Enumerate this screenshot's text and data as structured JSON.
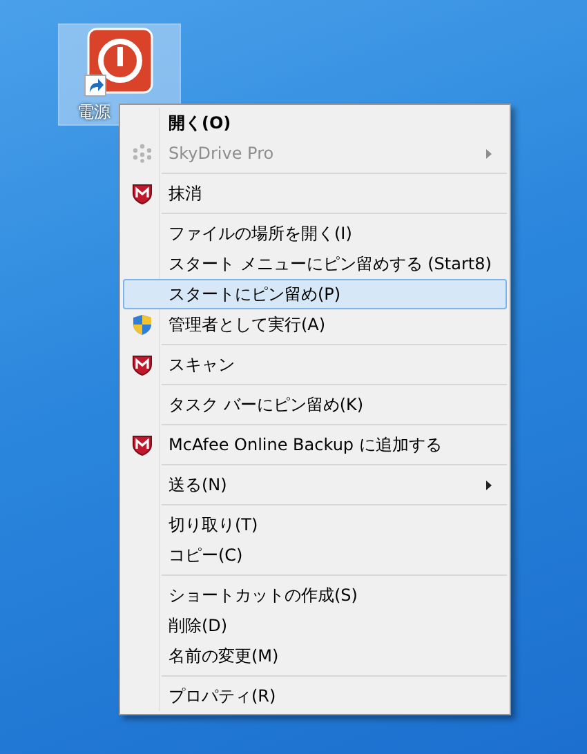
{
  "desktop_icon": {
    "label": "電源",
    "selected": true
  },
  "context_menu": {
    "items": [
      {
        "kind": "item",
        "label": "開く(O)",
        "bold": true,
        "disabled": false,
        "submenu": false,
        "selected": false
      },
      {
        "kind": "cloud-item",
        "label": "SkyDrive Pro",
        "bold": false,
        "disabled": true,
        "submenu": true,
        "selected": false
      },
      {
        "kind": "separator"
      },
      {
        "kind": "mcafee-item",
        "label": "抹消",
        "bold": false,
        "disabled": false,
        "submenu": false,
        "selected": false
      },
      {
        "kind": "separator"
      },
      {
        "kind": "item",
        "label": "ファイルの場所を開く(I)",
        "bold": false,
        "disabled": false,
        "submenu": false,
        "selected": false
      },
      {
        "kind": "item",
        "label": "スタート メニューにピン留めする (Start8)",
        "bold": false,
        "disabled": false,
        "submenu": false,
        "selected": false
      },
      {
        "kind": "item",
        "label": "スタートにピン留め(P)",
        "bold": false,
        "disabled": false,
        "submenu": false,
        "selected": true
      },
      {
        "kind": "admin-item",
        "label": "管理者として実行(A)",
        "bold": false,
        "disabled": false,
        "submenu": false,
        "selected": false
      },
      {
        "kind": "separator"
      },
      {
        "kind": "mcafee-item",
        "label": "スキャン",
        "bold": false,
        "disabled": false,
        "submenu": false,
        "selected": false
      },
      {
        "kind": "separator"
      },
      {
        "kind": "item",
        "label": "タスク バーにピン留め(K)",
        "bold": false,
        "disabled": false,
        "submenu": false,
        "selected": false
      },
      {
        "kind": "separator"
      },
      {
        "kind": "mcafee-item",
        "label": "McAfee Online Backup に追加する",
        "bold": false,
        "disabled": false,
        "submenu": false,
        "selected": false
      },
      {
        "kind": "separator"
      },
      {
        "kind": "item",
        "label": "送る(N)",
        "bold": false,
        "disabled": false,
        "submenu": true,
        "selected": false
      },
      {
        "kind": "separator"
      },
      {
        "kind": "item",
        "label": "切り取り(T)",
        "bold": false,
        "disabled": false,
        "submenu": false,
        "selected": false
      },
      {
        "kind": "item",
        "label": "コピー(C)",
        "bold": false,
        "disabled": false,
        "submenu": false,
        "selected": false
      },
      {
        "kind": "separator"
      },
      {
        "kind": "item",
        "label": "ショートカットの作成(S)",
        "bold": false,
        "disabled": false,
        "submenu": false,
        "selected": false
      },
      {
        "kind": "item",
        "label": "削除(D)",
        "bold": false,
        "disabled": false,
        "submenu": false,
        "selected": false
      },
      {
        "kind": "item",
        "label": "名前の変更(M)",
        "bold": false,
        "disabled": false,
        "submenu": false,
        "selected": false
      },
      {
        "kind": "separator"
      },
      {
        "kind": "item",
        "label": "プロパティ(R)",
        "bold": false,
        "disabled": false,
        "submenu": false,
        "selected": false
      }
    ]
  }
}
